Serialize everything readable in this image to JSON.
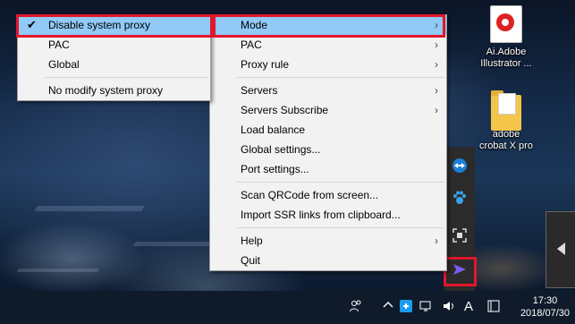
{
  "desktop": {
    "icons": [
      {
        "label_line1": "Ai.Adobe",
        "label_line2": "Illustrator ...",
        "icon": "pdf-file-icon"
      },
      {
        "label_line1": "adobe",
        "label_line2": "crobat X pro",
        "icon": "folder-icon"
      }
    ]
  },
  "submenu": {
    "items": [
      {
        "label": "Disable system proxy",
        "checked": true,
        "highlighted": true
      },
      {
        "label": "PAC",
        "checked": false
      },
      {
        "label": "Global",
        "checked": false
      },
      {
        "label": "No modify system proxy",
        "checked": false
      }
    ]
  },
  "main_menu": {
    "items": [
      {
        "label": "Mode",
        "has_submenu": true,
        "highlighted": true
      },
      {
        "label": "PAC",
        "has_submenu": true
      },
      {
        "label": "Proxy rule",
        "has_submenu": true
      },
      {
        "label": "Servers",
        "has_submenu": true
      },
      {
        "label": "Servers Subscribe",
        "has_submenu": true
      },
      {
        "label": "Load balance"
      },
      {
        "label": "Global settings..."
      },
      {
        "label": "Port settings..."
      },
      {
        "label": "Scan QRCode from screen..."
      },
      {
        "label": "Import SSR links from clipboard..."
      },
      {
        "label": "Help",
        "has_submenu": true
      },
      {
        "label": "Quit"
      }
    ],
    "arrow_glyph": "›"
  },
  "tray": {
    "icons": [
      "teamviewer-icon",
      "paw-icon",
      "screenshot-icon",
      "shadowsocks-plane-icon"
    ]
  },
  "taskbar": {
    "input_indicator": "A",
    "time": "17:30",
    "date": "2018/07/30"
  },
  "colors": {
    "highlight": "#91c9f7",
    "annotation_red": "#e3162c"
  }
}
